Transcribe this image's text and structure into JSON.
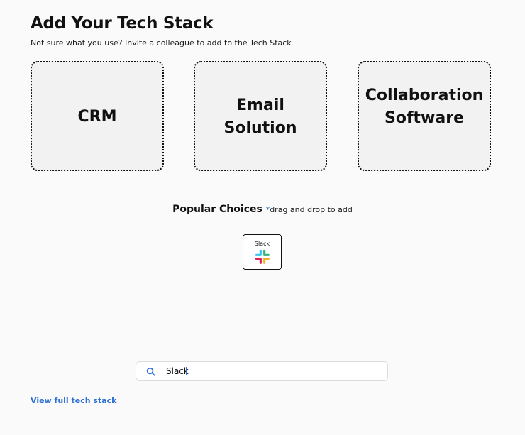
{
  "header": {
    "title": "Add Your Tech Stack",
    "subtitle": "Not sure what you use? Invite a colleague to add to the Tech Stack"
  },
  "drop_zones": [
    {
      "label": "CRM"
    },
    {
      "label": "Email Solution"
    },
    {
      "label": "Collaboration Software"
    }
  ],
  "popular": {
    "title": "Popular Choices",
    "asterisk": "*",
    "hint": "drag and drop to add",
    "items": [
      {
        "name": "Slack",
        "icon": "slack-logo-icon"
      }
    ]
  },
  "search": {
    "value": "Slack",
    "icon": "search-icon"
  },
  "footer": {
    "view_link": "View full tech stack"
  },
  "colors": {
    "accent": "#2b6fd6",
    "background": "#fafafa",
    "drop_zone_bg": "#f2f2f2"
  }
}
